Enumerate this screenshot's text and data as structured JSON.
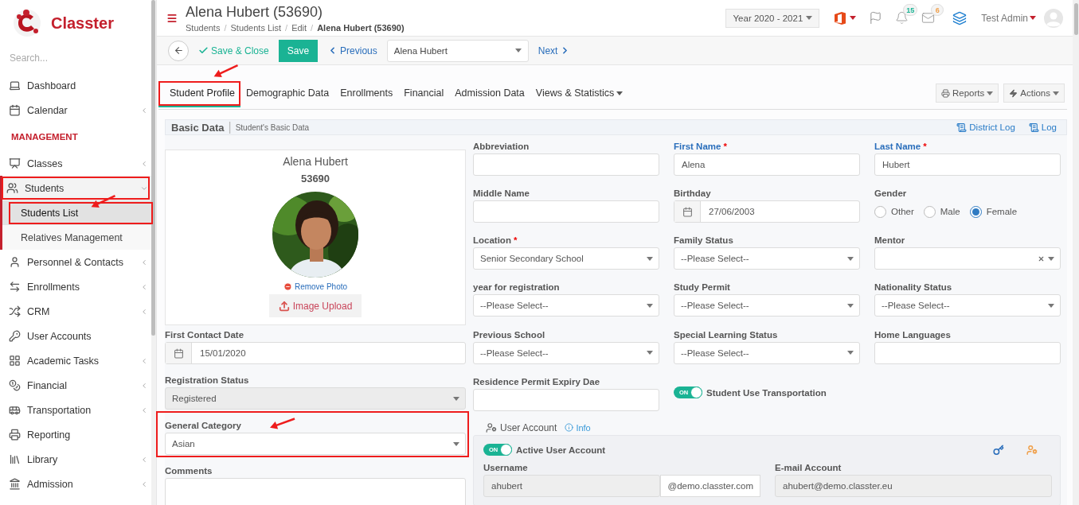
{
  "sidebar": {
    "logo": "Classter",
    "search_placeholder": "Search...",
    "items": [
      {
        "kind": "item",
        "label": "Dashboard",
        "has_arrow": false
      },
      {
        "kind": "item",
        "label": "Calendar",
        "has_arrow": true
      },
      {
        "kind": "heading",
        "label": "MANAGEMENT"
      },
      {
        "kind": "item",
        "label": "Classes",
        "has_arrow": true
      },
      {
        "kind": "item",
        "label": "Students",
        "has_arrow": true,
        "expanded": true,
        "annotated": true,
        "annotation_arrow": false,
        "children": [
          {
            "label": "Students List",
            "selected": true,
            "annotated": true,
            "annotation_arrow": true
          },
          {
            "label": "Relatives Management",
            "selected": false
          }
        ]
      },
      {
        "kind": "item",
        "label": "Personnel & Contacts",
        "has_arrow": true
      },
      {
        "kind": "item",
        "label": "Enrollments",
        "has_arrow": true
      },
      {
        "kind": "item",
        "label": "CRM",
        "has_arrow": true
      },
      {
        "kind": "item",
        "label": "User Accounts",
        "has_arrow": false
      },
      {
        "kind": "item",
        "label": "Academic Tasks",
        "has_arrow": true
      },
      {
        "kind": "item",
        "label": "Financial",
        "has_arrow": true
      },
      {
        "kind": "item",
        "label": "Transportation",
        "has_arrow": true
      },
      {
        "kind": "item",
        "label": "Reporting",
        "has_arrow": false
      },
      {
        "kind": "item",
        "label": "Library",
        "has_arrow": true
      },
      {
        "kind": "item",
        "label": "Admission",
        "has_arrow": true
      }
    ]
  },
  "header": {
    "title": "Alena Hubert (53690)",
    "breadcrumb": [
      "Students",
      "Students List",
      "Edit",
      "Alena Hubert (53690)"
    ],
    "breadcrumb_separator": "/",
    "year": "Year 2020 - 2021",
    "notifications": [
      {
        "count": "15",
        "color": "#1ab394"
      },
      {
        "count": "6",
        "color": "#f0a04b"
      }
    ],
    "user": "Test Admin"
  },
  "toolbar": {
    "save_close": "Save & Close",
    "save": "Save",
    "previous": "Previous",
    "record": "Alena Hubert",
    "next": "Next"
  },
  "tabs": [
    {
      "label": "Student Profile",
      "selected": true,
      "annotated": true,
      "annotation_arrow": true
    },
    {
      "label": "Demographic Data",
      "selected": false
    },
    {
      "label": "Enrollments",
      "selected": false
    },
    {
      "label": "Financial",
      "selected": false
    },
    {
      "label": "Admission Data",
      "selected": false
    },
    {
      "label": "Views & Statistics",
      "selected": false,
      "has_menu": true
    }
  ],
  "tab_actions": [
    "Reports",
    "Actions"
  ],
  "panel": {
    "title": "Basic Data",
    "subtitle_separator": "|",
    "subtitle": "Student's Basic Data",
    "links": [
      "District Log",
      "Log"
    ]
  },
  "profile": {
    "name": "Alena Hubert",
    "id": "53690",
    "remove_photo": "Remove Photo",
    "image_upload": "Image Upload"
  },
  "side_fields": [
    {
      "label": "First Contact Date",
      "kind": "date",
      "value": "15/01/2020"
    },
    {
      "label": "Registration Status",
      "kind": "select",
      "value": "Registered",
      "disabled": true
    },
    {
      "label": "General Category",
      "kind": "select",
      "value": "Asian",
      "annotated": true,
      "annotation_arrow": true
    },
    {
      "label": "Comments",
      "kind": "textarea"
    }
  ],
  "fields": [
    {
      "label": "Abbreviation",
      "kind": "text"
    },
    {
      "label": "First Name",
      "kind": "text",
      "value": "Alena",
      "required_mark": "*",
      "accent": true
    },
    {
      "label": "Last Name",
      "kind": "text",
      "value": "Hubert",
      "required_mark": "*",
      "accent": true
    },
    {
      "label": "Middle Name",
      "kind": "text"
    },
    {
      "label": "Birthday",
      "kind": "date",
      "value": "27/06/2003"
    },
    {
      "label": "Gender",
      "kind": "radio",
      "options": [
        {
          "label": "Other",
          "selected": false
        },
        {
          "label": "Male",
          "selected": false
        },
        {
          "label": "Female",
          "selected": true
        }
      ]
    },
    {
      "label": "Location",
      "kind": "select",
      "value": "Senior Secondary School",
      "required_mark": "*"
    },
    {
      "label": "Family Status",
      "kind": "select",
      "value": "--Please Select--"
    },
    {
      "label": "Mentor",
      "kind": "select",
      "clearable": true
    },
    {
      "label": "year for registration",
      "kind": "select",
      "value": "--Please Select--"
    },
    {
      "label": "Study Permit",
      "kind": "select",
      "value": "--Please Select--"
    },
    {
      "label": "Nationality Status",
      "kind": "select",
      "value": "--Please Select--"
    },
    {
      "label": "Previous School",
      "kind": "select",
      "value": "--Please Select--"
    },
    {
      "label": "Special Learning Status",
      "kind": "select",
      "value": "--Please Select--"
    },
    {
      "label": "Home Languages",
      "kind": "text"
    },
    {
      "label": "Residence Permit Expiry Dae",
      "kind": "text"
    },
    {
      "label": "Student Use Transportation",
      "kind": "toggle",
      "on": true,
      "on_text": "ON"
    }
  ],
  "user_account": {
    "title": "User Account",
    "info": "Info",
    "toggle": {
      "label": "Active User Account",
      "on": true,
      "on_text": "ON"
    },
    "username": {
      "label": "Username",
      "value": "ahubert",
      "addon": "@demo.classter.com"
    },
    "email": {
      "label": "E-mail Account",
      "value": "ahubert@demo.classter.eu"
    }
  }
}
